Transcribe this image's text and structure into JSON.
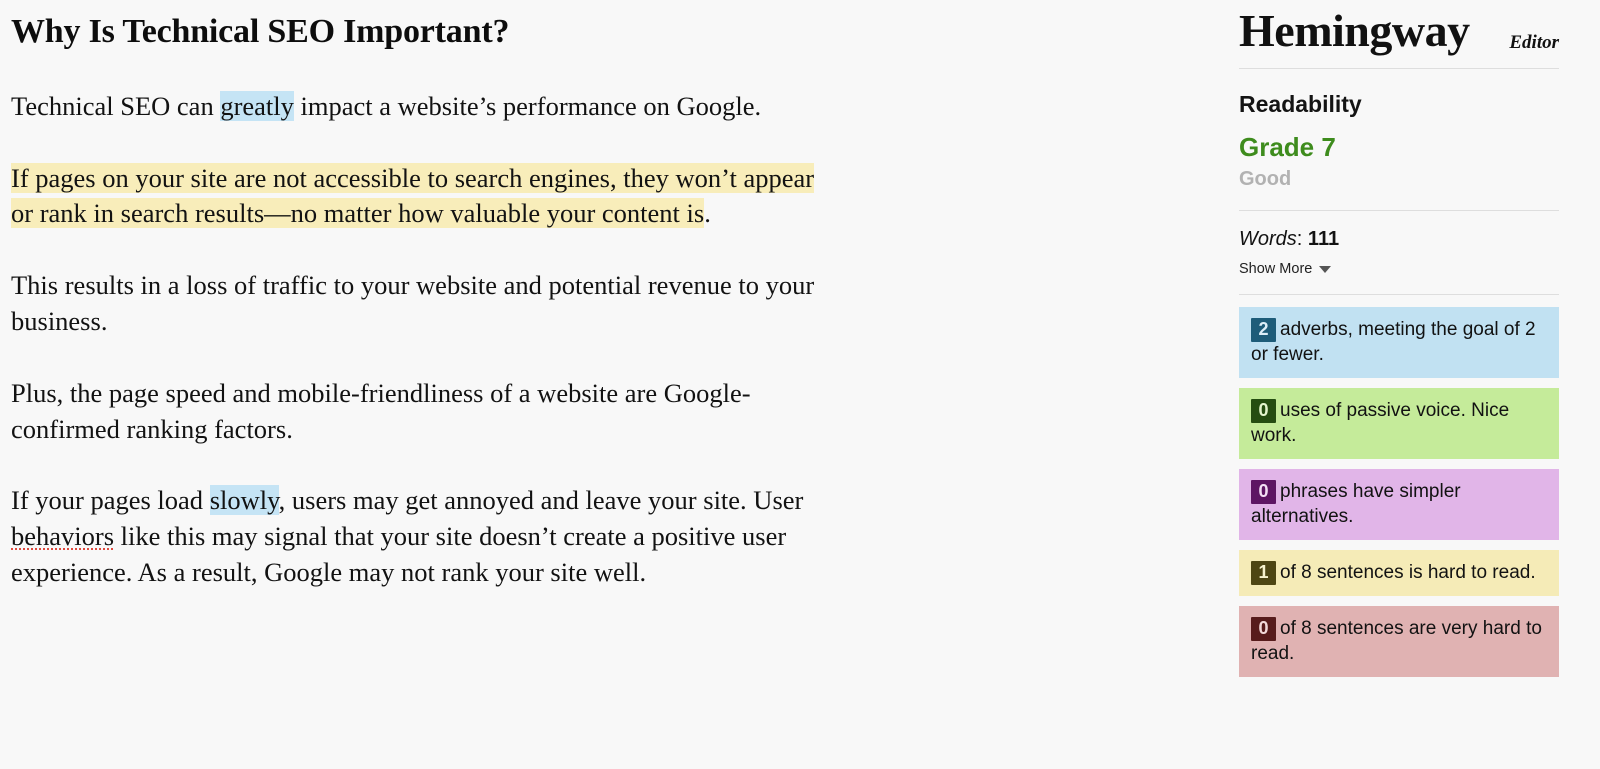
{
  "document": {
    "heading": "Why Is Technical SEO Important?",
    "paragraphs": [
      {
        "id": "p1",
        "segments": [
          {
            "text": "Technical SEO can ",
            "style": "plain"
          },
          {
            "text": "greatly",
            "style": "adverb"
          },
          {
            "text": " impact a website’s performance on Google.",
            "style": "plain"
          }
        ]
      },
      {
        "id": "p2",
        "segments": [
          {
            "text": "If pages on your site are not accessible to search engines, they won’t appear or rank in search results—no matter how valuable your content is",
            "style": "hard-sentence"
          },
          {
            "text": ".",
            "style": "plain"
          }
        ]
      },
      {
        "id": "p3",
        "segments": [
          {
            "text": "This results in a loss of traffic to your website and potential revenue to your business.",
            "style": "plain"
          }
        ]
      },
      {
        "id": "p4",
        "segments": [
          {
            "text": "Plus, the page speed and mobile-friendliness of a website are Google-confirmed ranking factors.",
            "style": "plain"
          }
        ]
      },
      {
        "id": "p5",
        "segments": [
          {
            "text": "If your pages load ",
            "style": "plain"
          },
          {
            "text": "slowly",
            "style": "adverb"
          },
          {
            "text": ", users may get annoyed and leave your site. User ",
            "style": "plain"
          },
          {
            "text": "behaviors",
            "style": "misspelled"
          },
          {
            "text": " like this may signal that your site doesn’t create a positive user experience. As a result, Google may not rank your site well.",
            "style": "plain"
          }
        ]
      }
    ]
  },
  "sidebar": {
    "logo": {
      "main": "Hemingway",
      "sub": "Editor"
    },
    "readability": {
      "title": "Readability",
      "grade": "Grade 7",
      "grade_color": "#3e8c1d",
      "description": "Good"
    },
    "words": {
      "label": "Words",
      "separator": ":",
      "count": "111",
      "show_more": "Show More"
    },
    "cards": [
      {
        "key": "adverbs",
        "count": "2",
        "text": "adverbs, meeting the goal of 2 or fewer.",
        "bg": "#c1e1f2",
        "badge_bg": "#1e5c79"
      },
      {
        "key": "passive",
        "count": "0",
        "text": "uses of passive voice. Nice work.",
        "bg": "#c5eb9a",
        "badge_bg": "#254d11"
      },
      {
        "key": "qualifier",
        "count": "0",
        "text": "phrases have simpler alternatives.",
        "bg": "#e1b5e8",
        "badge_bg": "#5d1563"
      },
      {
        "key": "hard",
        "count": "1",
        "text": "of 8 sentences is hard to read.",
        "bg": "#f5ebb7",
        "badge_bg": "#4e4613"
      },
      {
        "key": "veryhard",
        "count": "0",
        "text": "of 8 sentences are very hard to read.",
        "bg": "#e0b2b2",
        "badge_bg": "#571c1c"
      }
    ]
  },
  "colors": {
    "page_bg": "#f8f8f8",
    "adverb_highlight": "#c5e4f5",
    "hard_sentence_highlight": "#f8edba",
    "spellcheck_underline": "#e04a3f",
    "divider": "#dedede"
  }
}
